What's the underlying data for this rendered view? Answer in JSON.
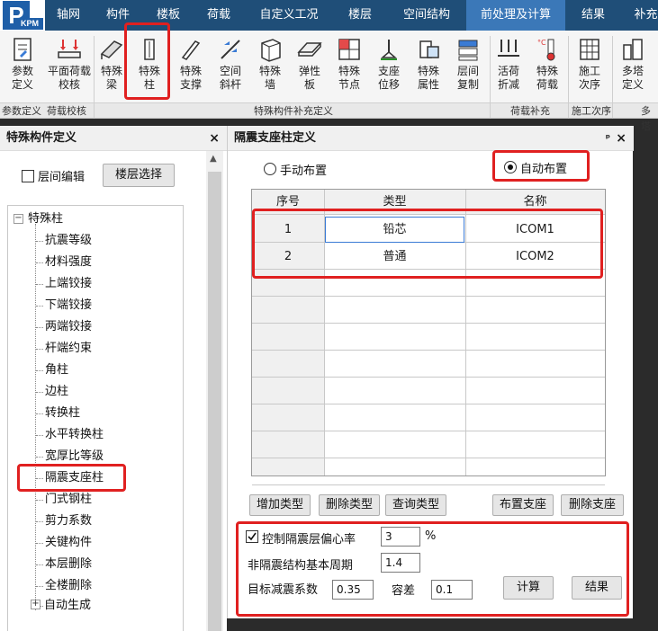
{
  "app": {
    "logo_main": "P",
    "logo_sub": "KPM"
  },
  "menu": {
    "items": [
      "轴网",
      "构件",
      "楼板",
      "荷载",
      "自定义工况",
      "楼层",
      "空间结构",
      "前处理及计算",
      "结果",
      "补充建"
    ]
  },
  "ribbon": {
    "buttons": [
      {
        "label": "参数\n定义"
      },
      {
        "label": "平面荷载\n校核"
      },
      {
        "label": "特殊\n梁"
      },
      {
        "label": "特殊\n柱"
      },
      {
        "label": "特殊\n支撑"
      },
      {
        "label": "空间\n斜杆"
      },
      {
        "label": "特殊\n墙"
      },
      {
        "label": "弹性\n板"
      },
      {
        "label": "特殊\n节点"
      },
      {
        "label": "支座\n位移"
      },
      {
        "label": "特殊\n属性"
      },
      {
        "label": "层间\n复制"
      },
      {
        "label": "活荷\n折减"
      },
      {
        "label": "特殊\n荷载"
      },
      {
        "label": "施工\n次序"
      },
      {
        "label": "多塔\n定义"
      }
    ],
    "groups": [
      "参数定义",
      "荷载校核",
      "特殊构件补充定义",
      "荷载补充",
      "施工次序",
      "多塔"
    ]
  },
  "left_panel": {
    "title": "特殊构件定义",
    "close": "×",
    "floor_edit_label": "层间编辑",
    "floor_select_button": "楼层选择",
    "tree": {
      "root": "特殊柱",
      "items": [
        "抗震等级",
        "材料强度",
        "上端铰接",
        "下端铰接",
        "两端铰接",
        "杆端约束",
        "角柱",
        "边柱",
        "转换柱",
        "水平转换柱",
        "宽厚比等级",
        "隔震支座柱",
        "门式钢柱",
        "剪力系数",
        "关键构件",
        "本层删除",
        "全楼删除"
      ],
      "auto_gen": "自动生成",
      "selected": "隔震支座柱"
    }
  },
  "right_panel": {
    "title": "隔震支座柱定义",
    "pin": "ᵖ",
    "close": "×",
    "manual_label": "手动布置",
    "auto_label": "自动布置",
    "auto_selected": true,
    "table": {
      "columns": [
        "序号",
        "类型",
        "名称"
      ],
      "rows": [
        {
          "no": "1",
          "type": "铅芯",
          "name": "ICOM1"
        },
        {
          "no": "2",
          "type": "普通",
          "name": "ICOM2"
        }
      ]
    },
    "buttons": {
      "add_type": "增加类型",
      "delete_type": "删除类型",
      "query_type": "查询类型",
      "place_support": "布置支座",
      "delete_support": "删除支座",
      "calculate": "计算",
      "result": "结果"
    },
    "params": {
      "control_eccentricity_label": "控制隔震层偏心率",
      "control_eccentricity_checked": true,
      "eccentricity_value": "3",
      "eccentricity_unit": "%",
      "period_label": "非隔震结构基本周期",
      "period_value": "1.4",
      "target_factor_label": "目标减震系数",
      "target_factor_value": "0.35",
      "tolerance_label": "容差",
      "tolerance_value": "0.1"
    }
  },
  "colors": {
    "menu_bg": "#1f4e78",
    "menu_active": "#3b78b8",
    "highlight": "#e02020"
  }
}
